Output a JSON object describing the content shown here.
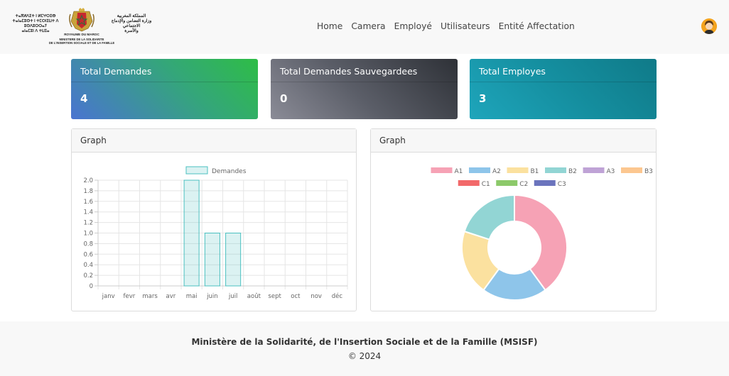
{
  "header": {
    "logo": {
      "latin_text": "ⵜⴰⴳⵍⴷⵉⵜ ⵏ ⵍⵎⵖⵔⵉⴱ\nⵜⴰⵏⴰⵎⵓⵙⵜ ⵏ ⵜⵎⵔⵏⵉⵡⵜ ⴷ ⵓⵙⴷⵓⵔⵔⴰⵢ\nⴰⵏⴰⵎⵓⵏ ⴷ ⵜⵡⵊⴰ",
      "arabic_text": "المملكة المغربية\nوزارة التضامن والإدماج الاجتماعي\nوالأسرة",
      "kingdom": "ROYAUME DU MAROC",
      "ministry": "MINISTERE DE LA SOLIDARITE\nDE L'INSERTION SOCIALE ET DE LA FAMILLE"
    },
    "nav": [
      "Home",
      "Camera",
      "Employé",
      "Utilisateurs",
      "Entité Affectation"
    ],
    "avatar_icon": "user-avatar-icon"
  },
  "cards": [
    {
      "title": "Total Demandes",
      "value": "4"
    },
    {
      "title": "Total Demandes Sauvegardees",
      "value": "0"
    },
    {
      "title": "Total Employes",
      "value": "3"
    }
  ],
  "panels": {
    "bar_title": "Graph",
    "doughnut_title": "Graph"
  },
  "chart_data": [
    {
      "type": "bar",
      "categories": [
        "janv",
        "fevr",
        "mars",
        "avr",
        "mai",
        "juin",
        "juil",
        "août",
        "sept",
        "oct",
        "nov",
        "déc"
      ],
      "series": [
        {
          "name": "Demandes",
          "values": [
            0,
            0,
            0,
            0,
            2,
            1,
            1,
            0,
            0,
            0,
            0,
            0
          ],
          "color": "#4bc0c0"
        }
      ],
      "y_ticks": [
        "0",
        "0.2",
        "0.4",
        "0.6",
        "0.8",
        "1.0",
        "1.2",
        "1.4",
        "1.6",
        "1.8",
        "2.0"
      ],
      "ylim": [
        0,
        2
      ],
      "grid": true,
      "legend": "top"
    },
    {
      "type": "pie",
      "variant": "doughnut",
      "labels": [
        "A1",
        "A2",
        "B1",
        "B2",
        "A3",
        "B3",
        "C1",
        "C2",
        "C3"
      ],
      "values": [
        2,
        1,
        1,
        1,
        0,
        0,
        0,
        0,
        0
      ],
      "colors": [
        "#f6a2b5",
        "#8ec5ea",
        "#fbe19f",
        "#92d5d4",
        "#bfa3d6",
        "#fcc790",
        "#f2696a",
        "#8cc96a",
        "#6b74bd"
      ],
      "legend": "top"
    }
  ],
  "footer": {
    "text": "Ministère de la Solidarité, de l'Insertion Sociale et de la Famille (MSISF)",
    "copyright": "© 2024"
  }
}
